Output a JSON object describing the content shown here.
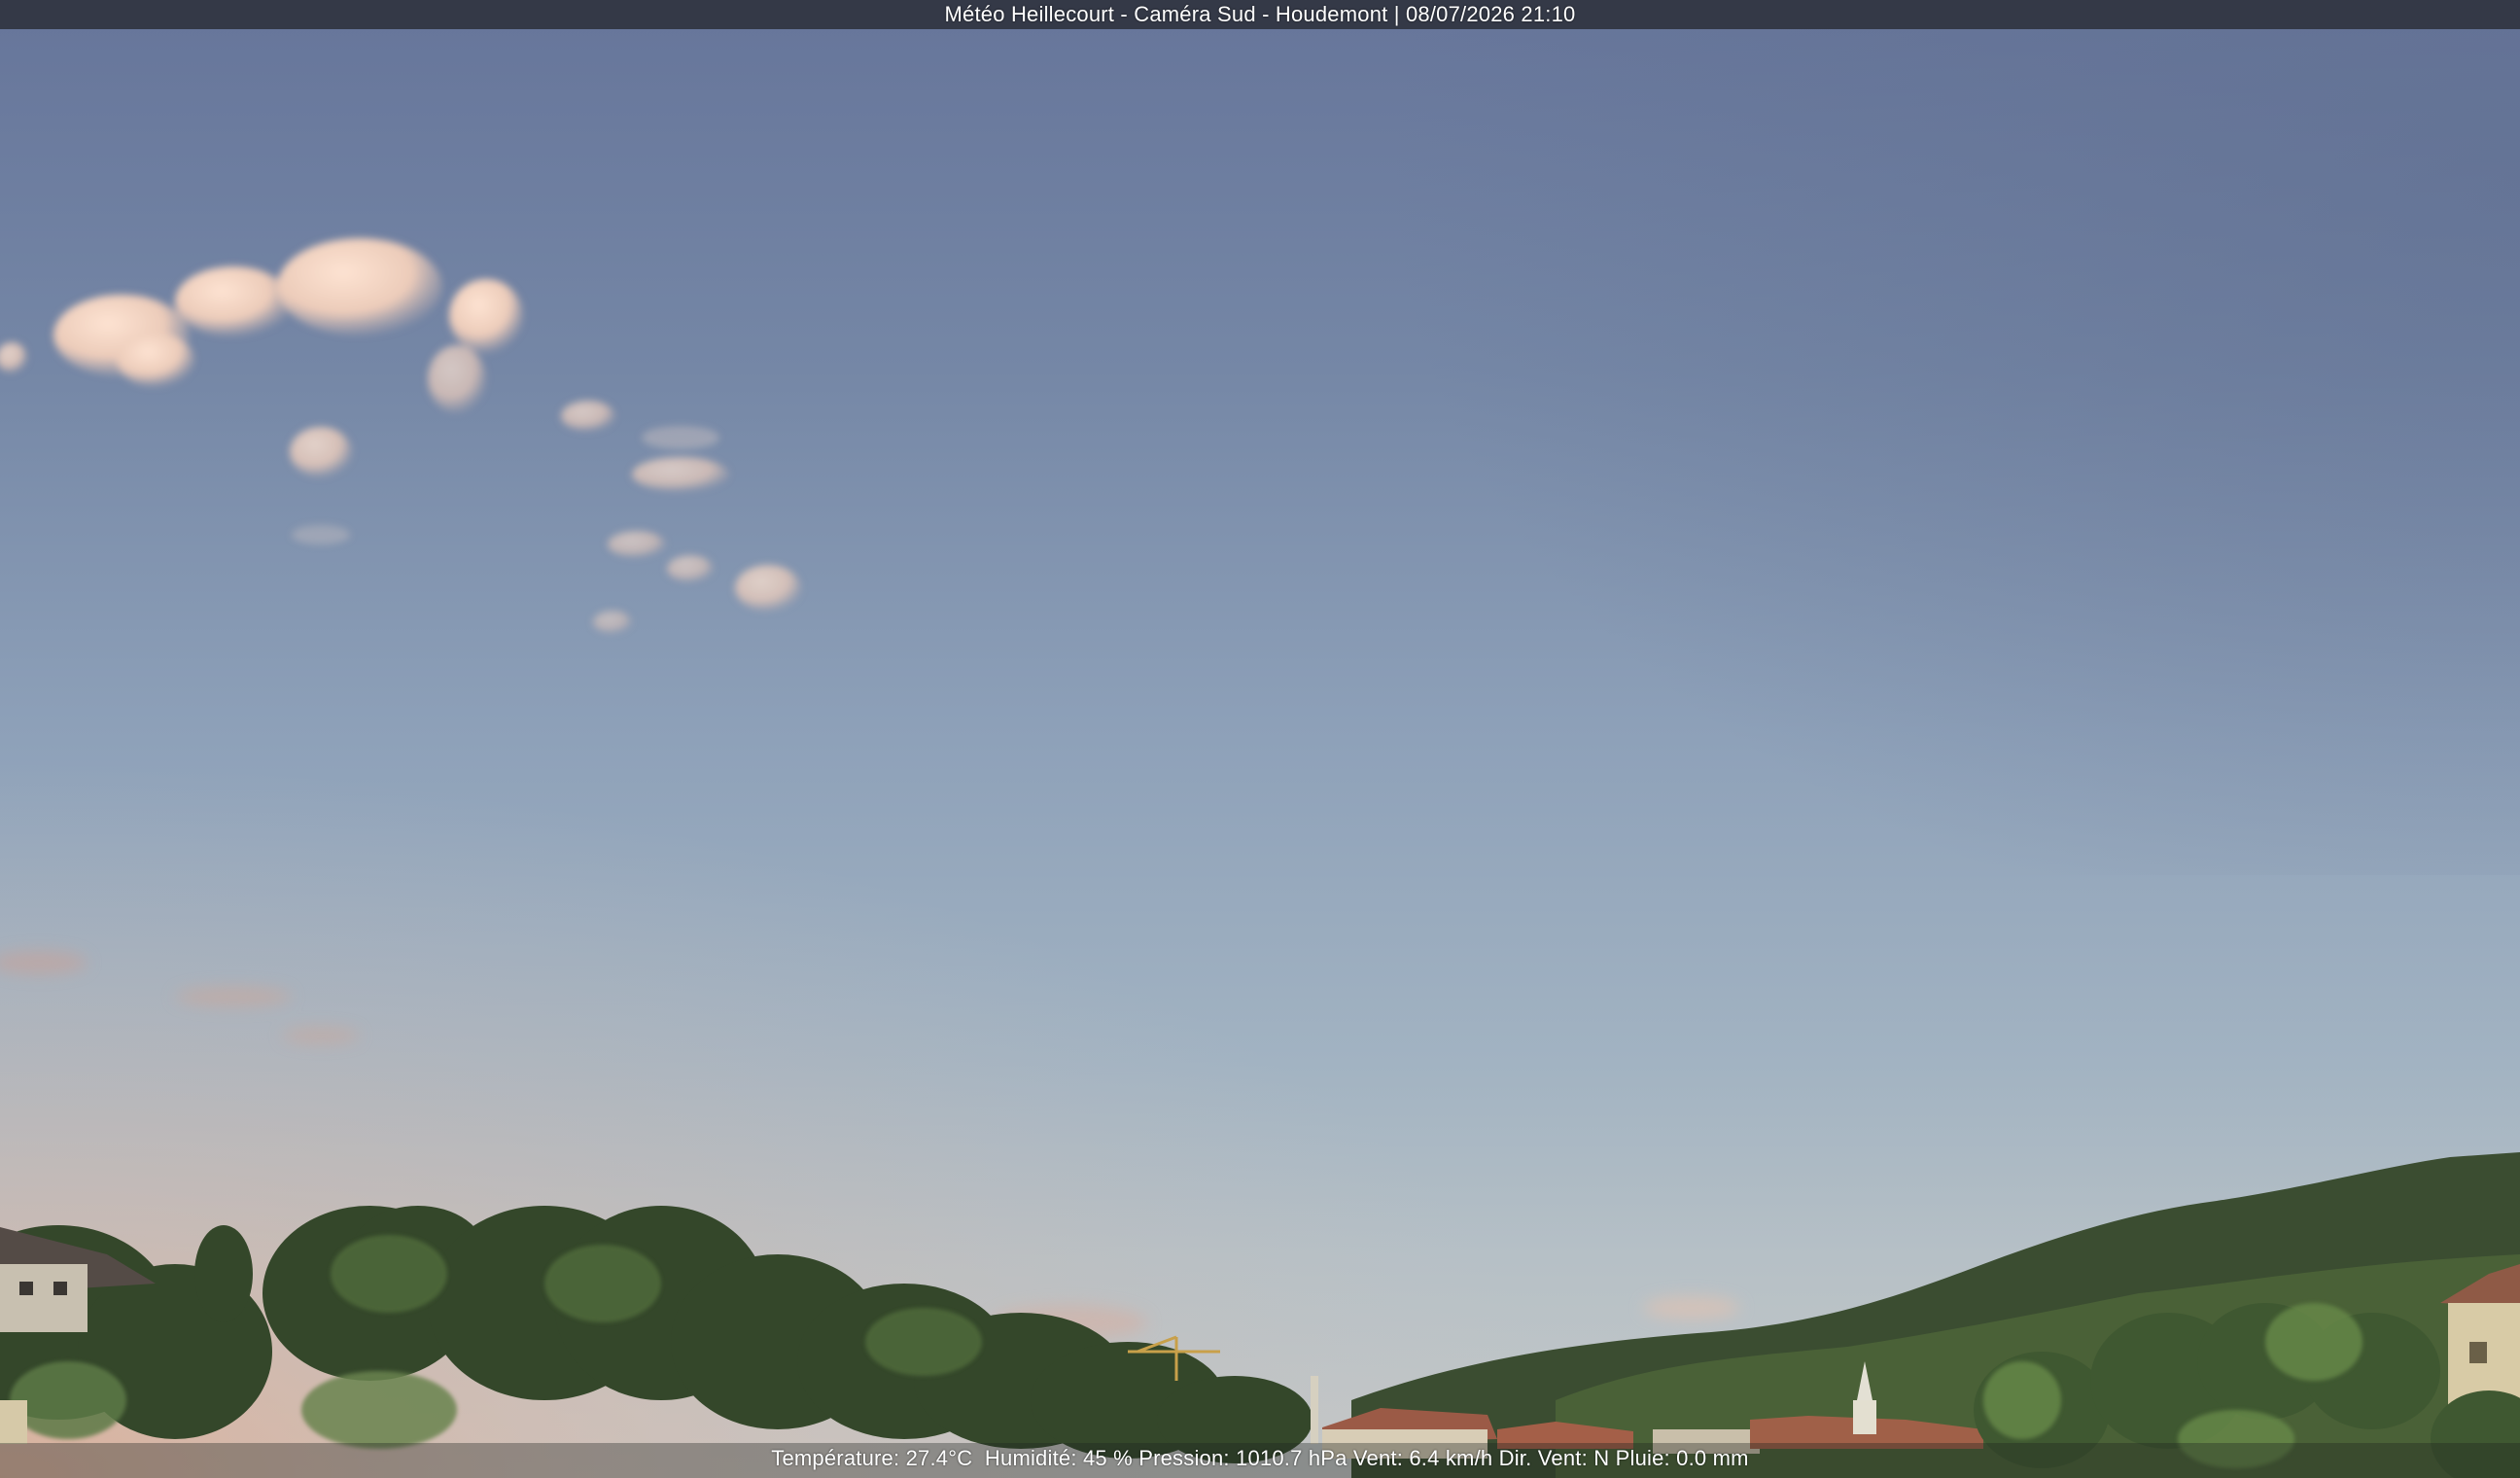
{
  "caption": {
    "title": "Météo Heillecourt - Caméra Sud - Houdemont | 08/07/2026 21:10"
  },
  "weather": {
    "text": "Température: 27.4°C  Humidité: 45 % Pression: 1010.7 hPa Vent: 6.4 km/h Dir. Vent: N Pluie: 0.0 mm"
  },
  "colors": {
    "sky_top": "#6a7998",
    "sky_mid": "#8fa3bd",
    "sky_low": "#a8b8c4",
    "horizon_glow": "#d4b5a5",
    "cloud": "#f2d0bd",
    "foliage_dark": "#2b3a24",
    "foliage_mid": "#3f5732",
    "foliage_light": "#5c7a40",
    "roof": "#a8604a",
    "wall": "#d8cfb8",
    "bar": "#303440"
  }
}
